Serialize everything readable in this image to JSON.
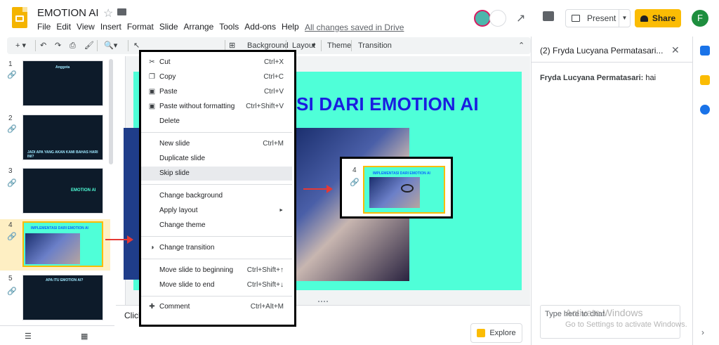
{
  "app": {
    "title": "EMOTION AI",
    "menu": [
      "File",
      "Edit",
      "View",
      "Insert",
      "Format",
      "Slide",
      "Arrange",
      "Tools",
      "Add-ons",
      "Help"
    ],
    "save_status": "All changes saved in Drive",
    "present_label": "Present",
    "share_label": "Share",
    "user_initial": "F"
  },
  "toolbar": {
    "background_label": "Background",
    "layout_label": "Layout",
    "theme_label": "Theme",
    "transition_label": "Transition"
  },
  "filmstrip": {
    "slides": [
      {
        "num": "1",
        "title": "Anggota"
      },
      {
        "num": "2",
        "title": "JADI APA YANG AKAN KAMI BAHAS HARI INI?"
      },
      {
        "num": "3",
        "title": "EMOTION AI"
      },
      {
        "num": "4",
        "title": "IMPLEMENTASI DARI EMOTION AI"
      },
      {
        "num": "5",
        "title": "APA ITU EMOTION AI?"
      }
    ],
    "selected_index": 3
  },
  "slide": {
    "title": "SI DARI EMOTION AI"
  },
  "popup_thumb": {
    "num": "4",
    "title": "IMPLEMENTASI DARI EMOTION AI"
  },
  "notes": {
    "text": "Click"
  },
  "explore": {
    "label": "Explore"
  },
  "context_menu": {
    "items": [
      {
        "icon": "scissors-icon",
        "glyph": "✂",
        "label": "Cut",
        "shortcut": "Ctrl+X"
      },
      {
        "icon": "copy-icon",
        "glyph": "❐",
        "label": "Copy",
        "shortcut": "Ctrl+C"
      },
      {
        "icon": "paste-icon",
        "glyph": "📋",
        "label": "Paste",
        "shortcut": "Ctrl+V"
      },
      {
        "icon": "paste-plain-icon",
        "glyph": "📋",
        "label": "Paste without formatting",
        "shortcut": "Ctrl+Shift+V"
      },
      {
        "icon": "",
        "glyph": "",
        "label": "Delete",
        "shortcut": ""
      },
      {
        "icon": "",
        "glyph": "",
        "label": "New slide",
        "shortcut": "Ctrl+M"
      },
      {
        "icon": "",
        "glyph": "",
        "label": "Duplicate slide",
        "shortcut": ""
      },
      {
        "icon": "",
        "glyph": "",
        "label": "Skip slide",
        "shortcut": ""
      },
      {
        "icon": "",
        "glyph": "",
        "label": "Change background",
        "shortcut": ""
      },
      {
        "icon": "",
        "glyph": "",
        "label": "Apply layout",
        "shortcut": "►"
      },
      {
        "icon": "",
        "glyph": "",
        "label": "Change theme",
        "shortcut": ""
      },
      {
        "icon": "transition-icon",
        "glyph": "◑",
        "label": "Change transition",
        "shortcut": ""
      },
      {
        "icon": "",
        "glyph": "",
        "label": "Move slide to beginning",
        "shortcut": "Ctrl+Shift+↑"
      },
      {
        "icon": "",
        "glyph": "",
        "label": "Move slide to end",
        "shortcut": "Ctrl+Shift+↓"
      },
      {
        "icon": "comment-add-icon",
        "glyph": "✚",
        "label": "Comment",
        "shortcut": "Ctrl+Alt+M"
      }
    ]
  },
  "chat": {
    "title": "(2) Fryda Lucyana Permatasari...",
    "message_author": "Fryda Lucyana Permatasari:",
    "message_text": "hai",
    "input_placeholder": "Type here to chat"
  },
  "watermark": {
    "line1": "Activate Windows",
    "line2": "Go to Settings to activate Windows."
  },
  "colors": {
    "slide_bg": "#4fffd8",
    "slide_title": "#1a1ee0",
    "share": "#fbbc04",
    "selected_thumb": "#feefc3"
  }
}
